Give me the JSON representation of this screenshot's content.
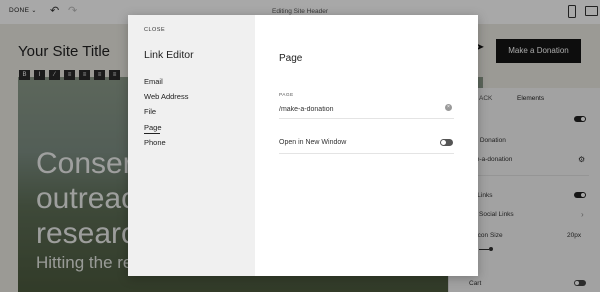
{
  "topbar": {
    "done_label": "DONE",
    "editing_title": "Editing Site Header",
    "icons": [
      "undo-icon",
      "redo-icon",
      "phone-icon",
      "desktop-icon"
    ]
  },
  "site": {
    "title": "Your Site Title",
    "cta_label": "Make a Donation",
    "hero_lines": [
      "Conser",
      "outreac",
      "researc"
    ],
    "hero_subline": "Hitting the reset button on the environment."
  },
  "side_panel": {
    "back_label": "ACK",
    "elements_label": "Elements",
    "rows": [
      {
        "label": "on",
        "control": "toggle-on"
      },
      {
        "label": "e a Donation",
        "control": "none"
      },
      {
        "label": "ake-a-donation",
        "control": "gear"
      },
      {
        "label": "ial Links",
        "control": "toggle-on"
      },
      {
        "label": "Social Links",
        "control": "chevron"
      },
      {
        "label": "al Icon Size",
        "value": "20px",
        "control": "value"
      },
      {
        "label": "Cart",
        "control": "toggle-off"
      }
    ]
  },
  "modal": {
    "close_label": "CLOSE",
    "title": "Link Editor",
    "nav": [
      {
        "label": "Email",
        "active": false
      },
      {
        "label": "Web Address",
        "active": false
      },
      {
        "label": "File",
        "active": false
      },
      {
        "label": "Page",
        "active": true
      },
      {
        "label": "Phone",
        "active": false
      }
    ],
    "page_heading": "Page",
    "field_label": "PAGE",
    "field_value": "/make-a-donation",
    "open_new_window_label": "Open in New Window",
    "open_new_window": false
  },
  "colors": {
    "overlay": "#000000",
    "cta_background": "#151515",
    "left_column": "#f0f0f0"
  }
}
